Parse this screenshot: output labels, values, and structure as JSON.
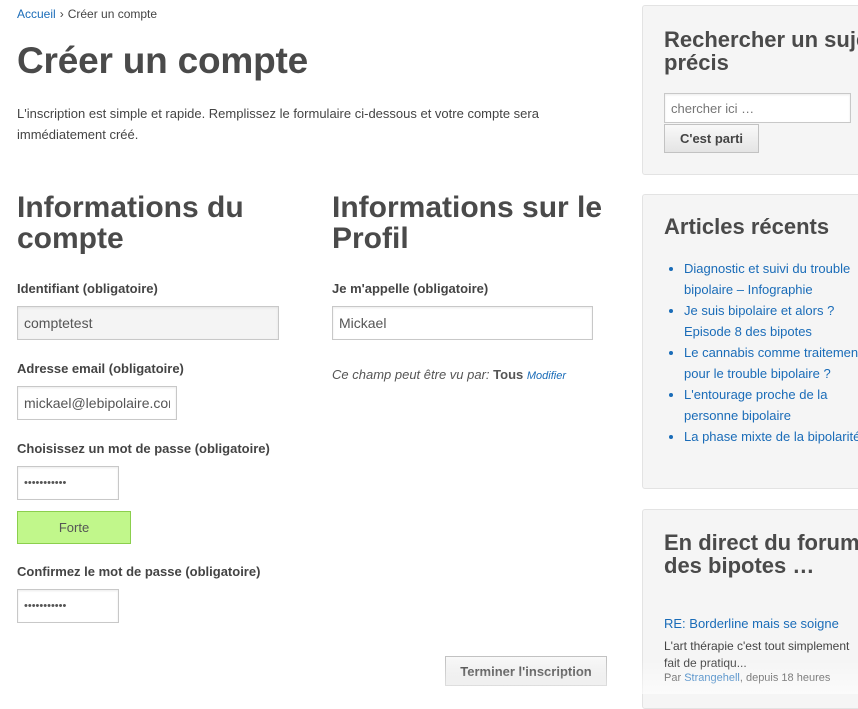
{
  "breadcrumb": {
    "home": "Accueil",
    "separator": "›",
    "current": "Créer un compte"
  },
  "page": {
    "title": "Créer un compte",
    "intro": "L'inscription est simple et rapide. Remplissez le formulaire ci-dessous et votre compte sera immédiatement créé."
  },
  "account": {
    "heading": "Informations du compte",
    "username_label": "Identifiant (obligatoire)",
    "username_value": "comptetest",
    "email_label": "Adresse email (obligatoire)",
    "email_value": "mickael@lebipolaire.com",
    "password_label": "Choisissez un mot de passe (obligatoire)",
    "password_value": "•••••••••••",
    "strength_label": "Forte",
    "confirm_label": "Confirmez le mot de passe (obligatoire)",
    "confirm_value": "•••••••••••"
  },
  "profile": {
    "heading": "Informations sur le Profil",
    "name_label": "Je m'appelle (obligatoire)",
    "name_value": "Mickael",
    "visibility_text": "Ce champ peut être vu par:",
    "visibility_value": "Tous",
    "visibility_link": "Modifier"
  },
  "submit_label": "Terminer l'inscription",
  "sidebar": {
    "search": {
      "title_line1": "Rechercher un sujet",
      "title_line2": "précis",
      "placeholder": "chercher ici …",
      "button": "C'est parti"
    },
    "recent": {
      "title": "Articles récents",
      "items": [
        {
          "line1": "Diagnostic et suivi du trouble",
          "line2": "bipolaire – Infographie"
        },
        {
          "line1": "Je suis bipolaire et alors ?",
          "line2": "Episode 8 des bipotes"
        },
        {
          "line1": "Le cannabis comme traitement",
          "line2": "pour le trouble bipolaire ?"
        },
        {
          "line1": "L'entourage proche de la",
          "line2": "personne bipolaire"
        },
        {
          "line1": "La phase mixte de la bipolarité",
          "line2": ""
        }
      ]
    },
    "forum": {
      "title_line1": "En direct du forum",
      "title_line2": "des bipotes …",
      "post_title": "RE: Borderline mais se soigne",
      "excerpt_line1": "L'art thérapie c'est tout simplement",
      "excerpt_line2": "fait de pratiqu...",
      "meta_prefix": "Par",
      "meta_author": "Strangehell",
      "meta_suffix": ", depuis 18 heures"
    }
  },
  "colors": {
    "link": "#1a6cb8",
    "strength_bg": "#c1f78b",
    "sidebar_bg": "#f5f5f5"
  }
}
